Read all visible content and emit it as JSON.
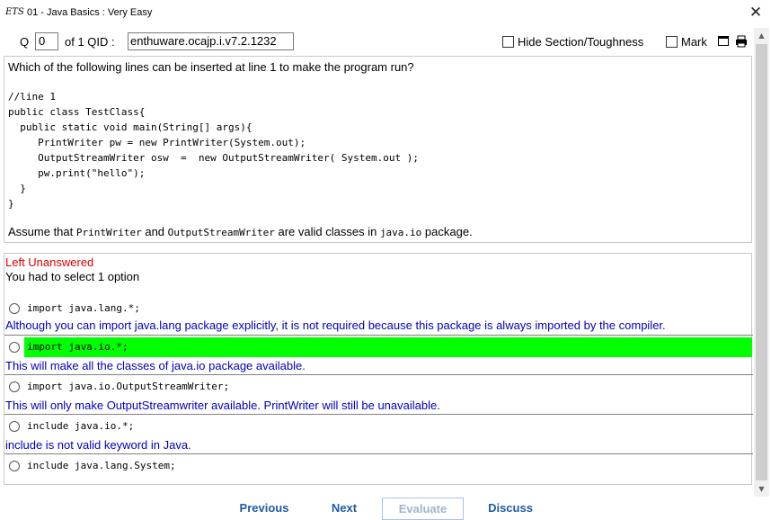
{
  "titlebar": {
    "icon_text": "ETS",
    "title": "01 - Java Basics  :  Very Easy",
    "close_glyph": "✕"
  },
  "toolbar": {
    "q_label": "Q",
    "q_value": "0",
    "of_label": "of 1  QID :",
    "qid_value": "enthuware.ocajp.i.v7.2.1232",
    "hide_section_label": "Hide Section/Toughness",
    "hide_section_checked": false,
    "mark_label": "Mark",
    "mark_checked": false,
    "window_icon": "window-icon",
    "print_icon": "print-icon"
  },
  "question": {
    "text": "Which of the following lines can be inserted at line 1 to make the program run?",
    "code": "//line 1\npublic class TestClass{\n  public static void main(String[] args){\n     PrintWriter pw = new PrintWriter(System.out);\n     OutputStreamWriter osw  =  new OutputStreamWriter( System.out );\n     pw.print(\"hello\");\n  }\n}",
    "note_prefix": "Assume that ",
    "note_class1": "PrintWriter",
    "note_and": " and ",
    "note_class2": "OutputStreamWriter",
    "note_mid": " are valid classes in ",
    "note_pkg": "java.io",
    "note_suffix": " package."
  },
  "answer": {
    "status": "Left Unanswered",
    "instruction": "You had to select 1 option",
    "options": [
      {
        "text": "import java.lang.*;",
        "explanation": "Although you can import java.lang package explicitly, it is not required because this package is always imported by the compiler.",
        "correct": false
      },
      {
        "text": "import java.io.*;",
        "explanation": "This will make all the classes of java.io package available.",
        "correct": true
      },
      {
        "text": "import java.io.OutputStreamWriter;",
        "explanation": "This will only make OutputStreamwriter available. PrintWriter will still be unavailable.",
        "correct": false
      },
      {
        "text": "include java.io.*;",
        "explanation": "include is not valid keyword in Java.",
        "correct": false
      },
      {
        "text": "include java.lang.System;",
        "explanation": "",
        "correct": false
      }
    ],
    "highlight_color": "#00ff00"
  },
  "nav": {
    "previous": "Previous",
    "next": "Next",
    "evaluate": "Evaluate",
    "discuss": "Discuss"
  },
  "scrollbar": {
    "up": "▲",
    "down": "▼"
  }
}
